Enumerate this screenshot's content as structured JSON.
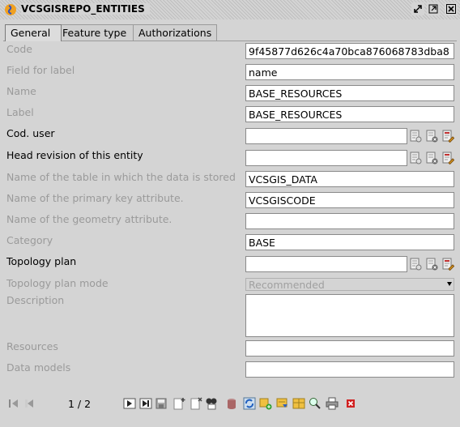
{
  "window": {
    "title": "VCSGISREPO_ENTITIES"
  },
  "tabs": [
    {
      "label": "General"
    },
    {
      "label": "Feature type"
    },
    {
      "label": "Authorizations"
    }
  ],
  "form": {
    "code": {
      "label": "Code",
      "value": "9f45877d626c4a70bca876068783dba8"
    },
    "field_for_label": {
      "label": "Field for label",
      "value": "name"
    },
    "name": {
      "label": "Name",
      "value": "BASE_RESOURCES"
    },
    "label_field": {
      "label": "Label",
      "value": "BASE_RESOURCES"
    },
    "cod_user": {
      "label": "Cod. user",
      "value": ""
    },
    "head_revision": {
      "label": "Head revision of this entity",
      "value": ""
    },
    "table_name": {
      "label": "Name of the table in which the data is stored",
      "value": "VCSGIS_DATA"
    },
    "pk_attr": {
      "label": "Name of the primary key attribute.",
      "value": "VCSGISCODE"
    },
    "geom_attr": {
      "label": "Name of the geometry attribute.",
      "value": ""
    },
    "category": {
      "label": "Category",
      "value": "BASE"
    },
    "topology_plan": {
      "label": "Topology plan",
      "value": ""
    },
    "topology_plan_mode": {
      "label": "Topology plan mode",
      "value": "Recommended"
    },
    "description": {
      "label": "Description",
      "value": ""
    },
    "resources": {
      "label": "Resources",
      "value": ""
    },
    "data_models": {
      "label": "Data models",
      "value": ""
    }
  },
  "pager": {
    "text": "1 / 2"
  },
  "colors": {
    "background": "#d4d4d4",
    "disabled_label": "#9a9a9a",
    "field_bg": "#ffffff"
  }
}
